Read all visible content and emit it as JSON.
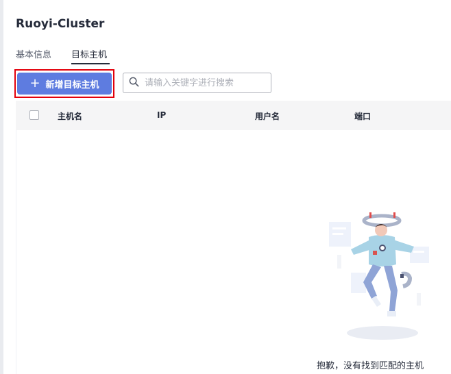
{
  "page": {
    "title": "Ruoyi-Cluster"
  },
  "tabs": [
    {
      "label": "基本信息"
    },
    {
      "label": "目标主机"
    }
  ],
  "toolbar": {
    "add_label": "新增目标主机",
    "search_placeholder": "请输入关键字进行搜索"
  },
  "table": {
    "columns": [
      "主机名",
      "IP",
      "用户名",
      "端口"
    ],
    "empty_text": "抱歉，没有找到匹配的主机"
  },
  "colors": {
    "primary": "#5e7ce0",
    "highlight": "#e3000b"
  }
}
